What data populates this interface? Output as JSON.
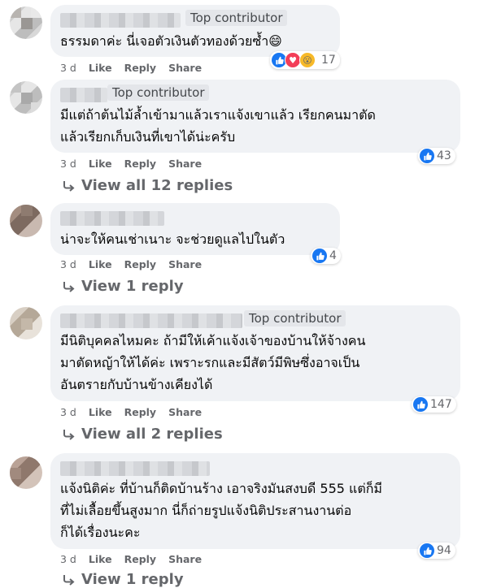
{
  "badge_label": "Top contributor",
  "actions": {
    "like": "Like",
    "reply": "Reply",
    "share": "Share"
  },
  "comments": [
    {
      "time": "3 d",
      "lines": [
        "ธรรมดาค่ะ นี่เจอตัวเงินตัวทองด้วยซ้ำ😄"
      ],
      "reactions": "17",
      "top_contributor": true
    },
    {
      "time": "3 d",
      "lines": [
        "มีแต่ถ้าต้นไม้ล้ำเข้ามาแล้วเราแจ้งเขาแล้ว เรียกคนมาตัด",
        "แล้วเรียกเก็บเงินที่เขาได้น่ะครับ"
      ],
      "reactions": "43",
      "top_contributor": true,
      "view_replies": "View all 12 replies"
    },
    {
      "time": "3 d",
      "lines": [
        "น่าจะให้คนเช่าเนาะ จะช่วยดูแลไปในตัว"
      ],
      "reactions": "4",
      "top_contributor": false,
      "view_replies": "View 1 reply"
    },
    {
      "time": "3 d",
      "lines": [
        "มีนิติบุคคลไหมคะ ถ้ามีให้เค้าแจ้งเจ้าของบ้านให้จ้างคน",
        "มาตัดหญ้าให้ได้ค่ะ เพราะรกและมีสัตว์มีพิษซึ่งอาจเป็น",
        "อันตรายกับบ้านข้างเคียงได้"
      ],
      "reactions": "147",
      "top_contributor": true,
      "view_replies": "View all 2 replies"
    },
    {
      "time": "3 d",
      "lines": [
        "แจ้งนิติค่ะ ที่บ้านก็ติดบ้านร้าง เอาจริงมันสงบดี 555 แต่ก็มี",
        "ที่ไม่เลื้อยขึ้นสูงมาก นี่ก็ถ่ายรูปแจ้งนิติประสานงานต่อ",
        "ก็ได้เรื่องนะคะ"
      ],
      "reactions": "94",
      "top_contributor": false,
      "view_replies": "View 1 reply"
    }
  ]
}
